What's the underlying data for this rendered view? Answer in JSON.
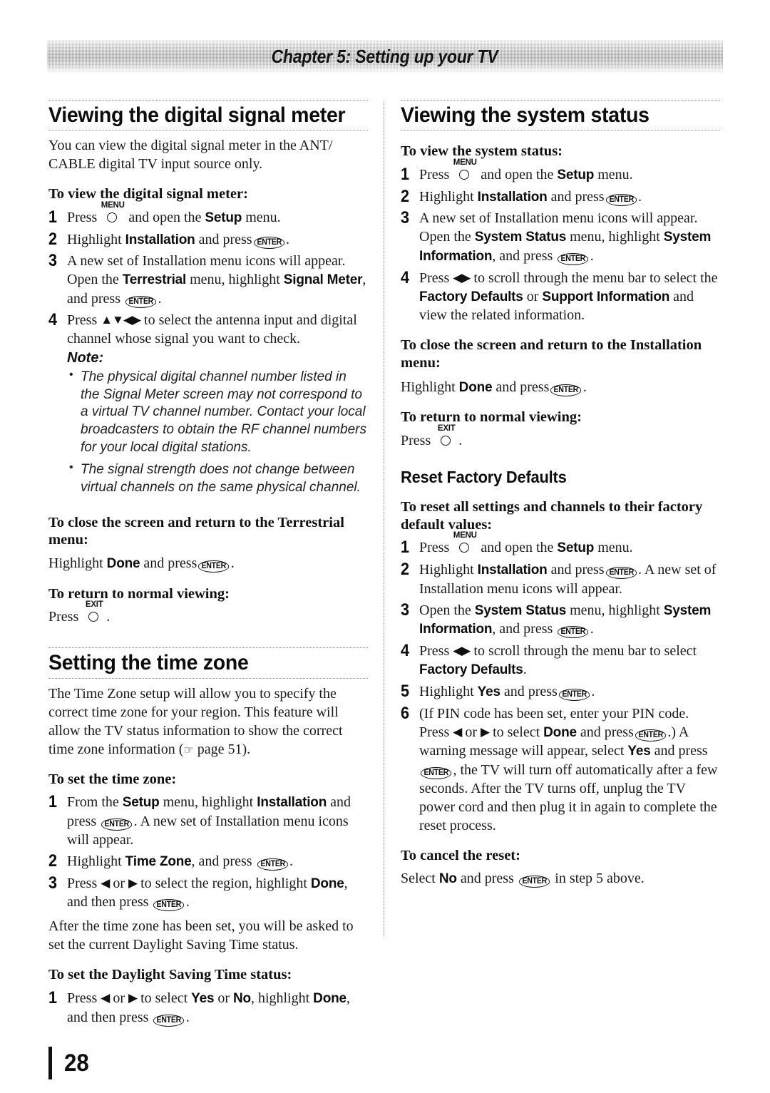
{
  "header": {
    "chapter_title": "Chapter 5: Setting up your TV"
  },
  "icons": {
    "enter_label": "ENTER",
    "menu_label": "MENU",
    "exit_label": "EXIT",
    "arrow_up": "▲",
    "arrow_down": "▼",
    "arrow_left": "◀",
    "arrow_right": "▶",
    "pointing_hand": "☞",
    "bullet": "•"
  },
  "left_column": {
    "section1": {
      "heading": "Viewing the digital signal meter",
      "intro": "You can view the digital signal meter in the ANT/ CABLE digital TV input source only.",
      "task1_heading": "To view the digital signal meter:",
      "steps": [
        {
          "num": "1",
          "pre": "Press",
          "key": "MENU",
          "post_a": "and open the",
          "bold_a": "Setup",
          "post_b": "menu."
        },
        {
          "num": "2",
          "pre": "Highlight",
          "bold_a": "Installation",
          "post_a": "and press",
          "key": "ENTER",
          "post_b": "."
        },
        {
          "num": "3",
          "line1": "A new set of Installation menu icons will appear. Open the",
          "bold_a": "Terrestrial",
          "mid1": "menu, highlight",
          "bold_b": "Signal Meter",
          "mid2": ", and press",
          "key": "ENTER",
          "post_b": "."
        },
        {
          "num": "4",
          "pre": "Press",
          "arrows": "▲▼◀▶",
          "post_a": "to select the antenna input and digital channel whose signal you want to check."
        }
      ],
      "note_label": "Note:",
      "notes": [
        "The physical digital channel number listed in the Signal Meter screen may not correspond to a virtual TV channel number. Contact your local broadcasters to obtain the RF channel numbers for your local digital stations.",
        "The signal strength does not change between virtual channels on the same physical channel."
      ],
      "task2_heading": "To close the screen and return to the Terrestrial menu:",
      "task2_body_pre": "Highlight",
      "task2_body_bold": "Done",
      "task2_body_mid": "and press",
      "task2_body_post": ".",
      "task3_heading": "To return to normal viewing:",
      "task3_body_pre": "Press",
      "task3_body_post": "."
    },
    "section2": {
      "heading": "Setting the time zone",
      "intro_a": "The Time Zone setup will allow you to specify the correct time zone for your region. This feature will allow the TV status information to show the correct time zone information (",
      "intro_page_ref": "page 51",
      "intro_b": ").",
      "task1_heading": "To set the time zone:",
      "steps": [
        {
          "num": "1",
          "pre": "From the",
          "bold_a": "Setup",
          "mid1": "menu, highlight",
          "bold_b": "Installation",
          "mid2": "and press",
          "key": "ENTER",
          "post": ". A new set of Installation menu icons will appear."
        },
        {
          "num": "2",
          "pre": "Highlight",
          "bold_a": "Time Zone",
          "mid1": ", and press",
          "key": "ENTER",
          "post": "."
        },
        {
          "num": "3",
          "pre": "Press",
          "arrow_l": "◀",
          "or": "or",
          "arrow_r": "▶",
          "mid1": "to select the region, highlight",
          "bold_a": "Done",
          "mid2": ", and then press",
          "key": "ENTER",
          "post": "."
        }
      ],
      "after_note": "After the time zone has been set, you will be asked to set the current Daylight Saving Time status.",
      "task2_heading": "To set the Daylight Saving Time status:",
      "steps2": [
        {
          "num": "1",
          "pre": "Press",
          "arrow_l": "◀",
          "or": "or",
          "arrow_r": "▶",
          "mid1": "to select",
          "bold_a": "Yes",
          "mid2": "or",
          "bold_b": "No",
          "mid3": ", highlight",
          "bold_c": "Done",
          "mid4": ", and then press",
          "key": "ENTER",
          "post": "."
        }
      ]
    }
  },
  "right_column": {
    "section1": {
      "heading": "Viewing the system status",
      "task1_heading": "To view the system status:",
      "steps": [
        {
          "num": "1",
          "pre": "Press",
          "key": "MENU",
          "post_a": "and open the",
          "bold_a": "Setup",
          "post_b": "menu."
        },
        {
          "num": "2",
          "pre": "Highlight",
          "bold_a": "Installation",
          "post_a": "and press",
          "key": "ENTER",
          "post_b": "."
        },
        {
          "num": "3",
          "line1": "A new set of Installation menu icons will appear. Open the",
          "bold_a": "System Status",
          "mid1": "menu, highlight",
          "bold_b": "System Information",
          "mid2": ", and press",
          "key": "ENTER",
          "post_b": "."
        },
        {
          "num": "4",
          "pre": "Press",
          "arrows": "◀▶",
          "mid1": "to scroll through the menu bar to select the",
          "bold_a": "Factory Defaults",
          "mid2": "or",
          "bold_b": "Support Information",
          "mid3": "and view the related information."
        }
      ],
      "task2_heading": "To close the screen and return to the Installation menu:",
      "task2_body_pre": "Highlight",
      "task2_body_bold": "Done",
      "task2_body_mid": "and press",
      "task2_body_post": ".",
      "task3_heading": "To return to normal viewing:",
      "task3_body_pre": "Press",
      "task3_body_post": "."
    },
    "section2": {
      "heading": "Reset Factory Defaults",
      "task1_heading": "To reset all settings and channels to their factory default values:",
      "steps": [
        {
          "num": "1",
          "pre": "Press",
          "key": "MENU",
          "post_a": "and open the",
          "bold_a": "Setup",
          "post_b": "menu."
        },
        {
          "num": "2",
          "pre": "Highlight",
          "bold_a": "Installation",
          "mid1": "and press",
          "key": "ENTER",
          "post": ". A new set of Installation menu icons will appear."
        },
        {
          "num": "3",
          "pre": "Open the",
          "bold_a": "System Status",
          "mid1": "menu, highlight",
          "bold_b": "System Information",
          "mid2": ", and press",
          "key": "ENTER",
          "post": "."
        },
        {
          "num": "4",
          "pre": "Press",
          "arrows": "◀▶",
          "mid1": "to scroll through the menu bar to select",
          "bold_a": "Factory Defaults",
          "post": "."
        },
        {
          "num": "5",
          "pre": "Highlight",
          "bold_a": "Yes",
          "mid1": "and press",
          "key": "ENTER",
          "post": "."
        },
        {
          "num": "6",
          "pre": "(If PIN code has been set, enter your PIN code. Press",
          "arrow_l": "◀",
          "or": "or",
          "arrow_r": "▶",
          "mid1": "to select",
          "bold_a": "Done",
          "mid2": "and press",
          "key": "ENTER",
          "mid3": ".) A warning message will appear, select",
          "bold_b": "Yes",
          "mid4": "and press",
          "key2": "ENTER",
          "post": ", the TV will turn off automatically after a few seconds. After the TV turns off, unplug the TV power cord and then plug it in again to complete the reset process."
        }
      ],
      "task2_heading": "To cancel the reset:",
      "task2_body_pre": "Select",
      "task2_body_bold": "No",
      "task2_body_mid": "and press",
      "task2_body_post": "in step 5 above."
    }
  },
  "footer": {
    "page_number": "28"
  }
}
